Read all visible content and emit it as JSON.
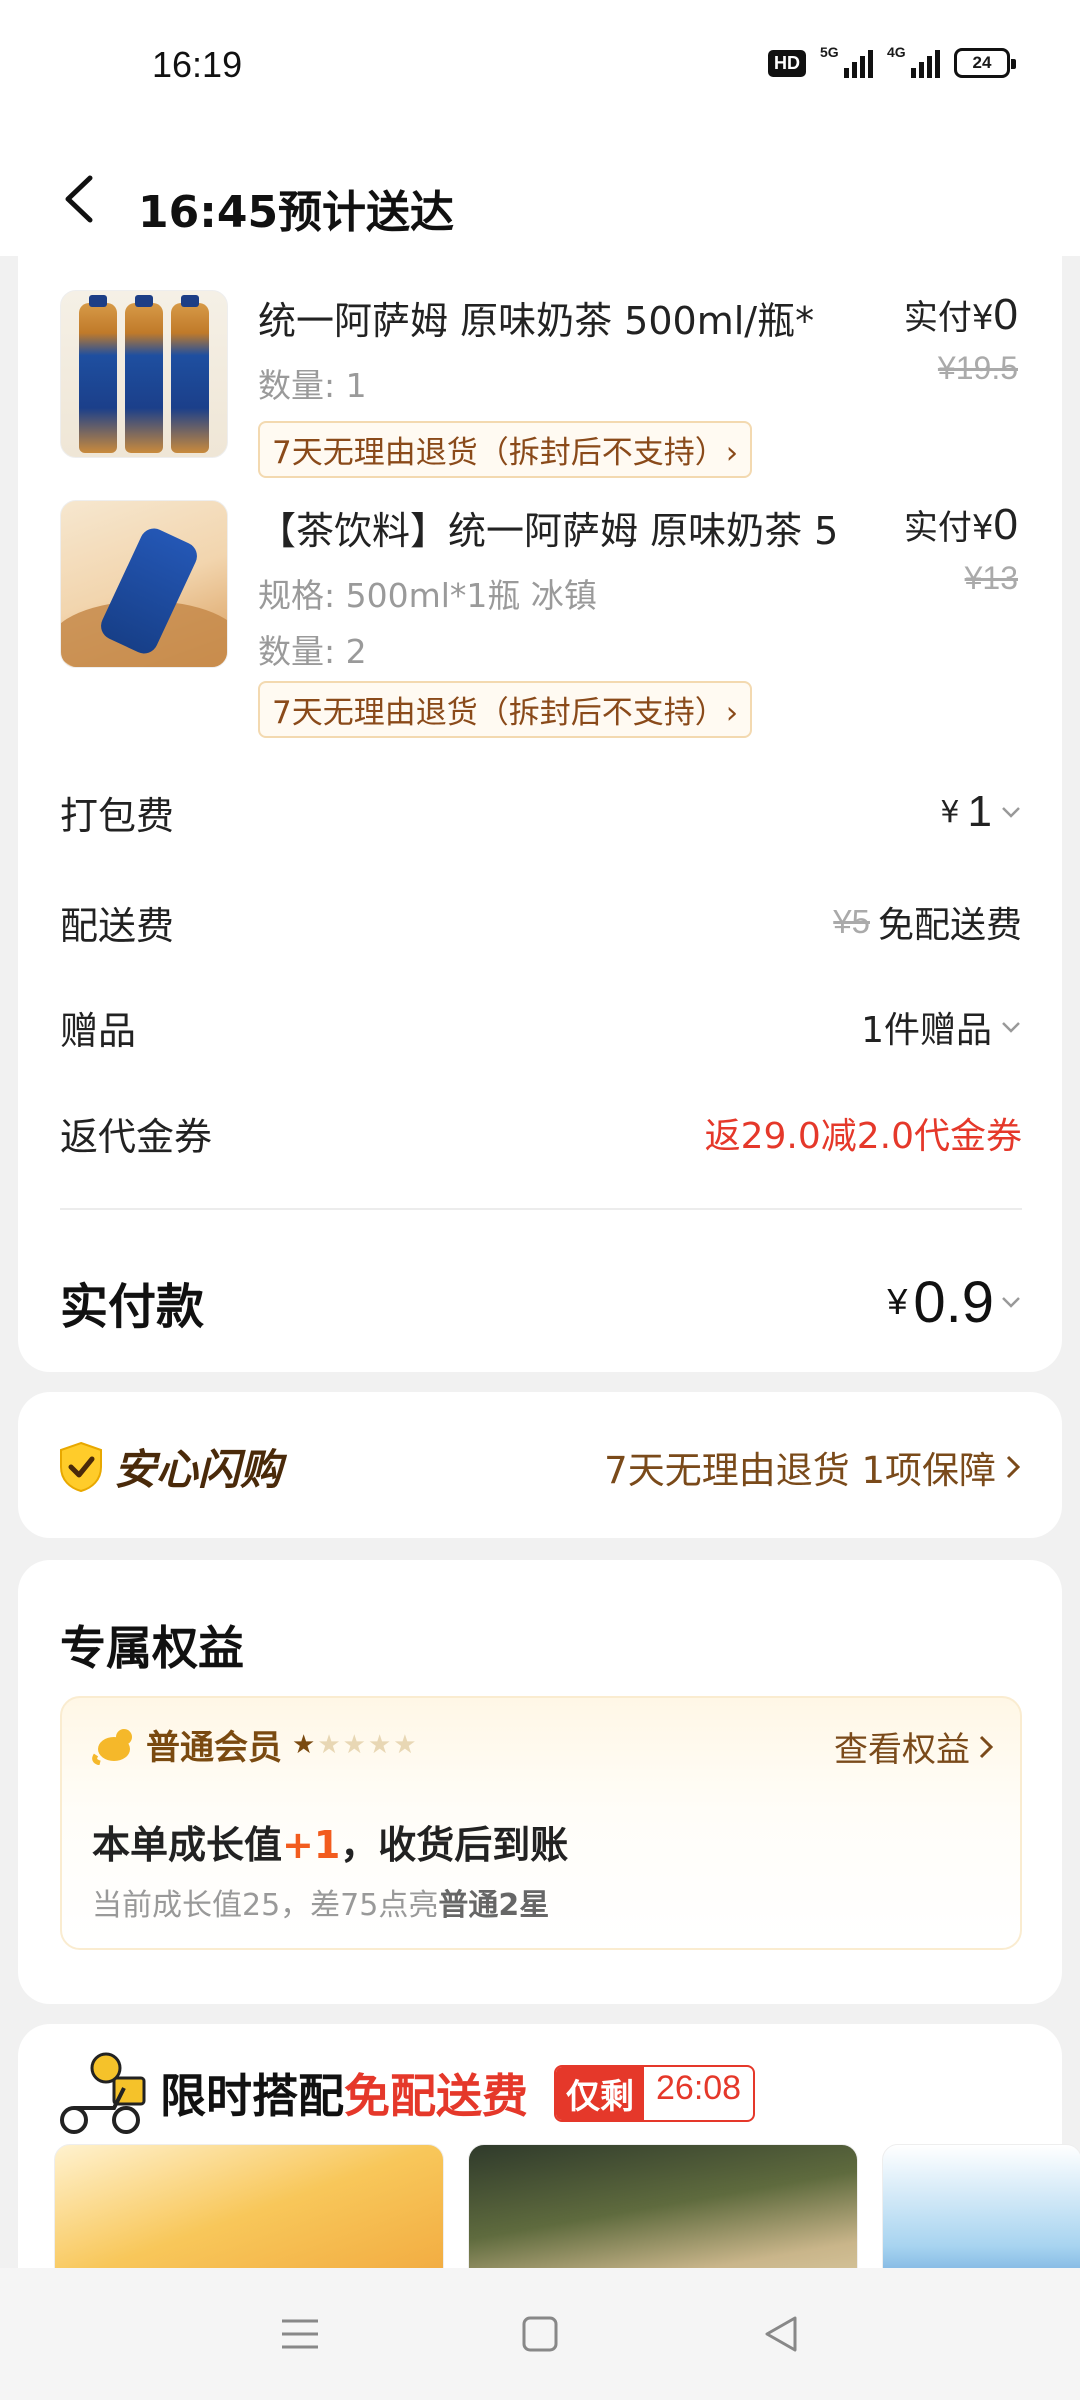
{
  "status_bar": {
    "time": "16:19",
    "hd": "HD",
    "net1": "5G",
    "net2": "4G",
    "battery": "24"
  },
  "header": {
    "title": "16:45预计送达"
  },
  "products": [
    {
      "name": "统一阿萨姆 原味奶茶 500ml/瓶*",
      "qty": "数量: 1",
      "paid_label": "实付¥",
      "paid_value": "0",
      "original_price": "¥19.5",
      "return_tag": "7天无理由退货（拆封后不支持）›"
    },
    {
      "name": "【茶饮料】统一阿萨姆 原味奶茶 5",
      "spec": "规格: 500ml*1瓶 冰镇",
      "qty": "数量: 2",
      "paid_label": "实付¥",
      "paid_value": "0",
      "original_price": "¥13",
      "return_tag": "7天无理由退货（拆封后不支持）›"
    }
  ],
  "fees": {
    "packing_label": "打包费",
    "packing_yen": "¥",
    "packing_value": "1",
    "delivery_label": "配送费",
    "delivery_original": "¥5",
    "delivery_value": "免配送费",
    "gift_label": "赠品",
    "gift_value": "1件赠品",
    "voucher_label": "返代金券",
    "voucher_value": "返29.0减2.0代金券"
  },
  "total": {
    "label": "实付款",
    "yen": "¥",
    "value": "0.9"
  },
  "safe_buy": {
    "title": "安心闪购",
    "detail": "7天无理由退货 1项保障"
  },
  "benefits": {
    "title": "专属权益",
    "member_level": "普通会员",
    "stars_on": 1,
    "stars_total": 5,
    "view_link": "查看权益",
    "growth_prefix": "本单成长值",
    "growth_value": "+1",
    "growth_suffix": "，收货后到账",
    "growth_sub_prefix": "当前成长值25，差75点亮",
    "growth_sub_target": "普通2星"
  },
  "flash": {
    "title_prefix": "限时搭配",
    "title_highlight": "免配送费",
    "timer_label": "仅剩",
    "timer_value": "26:08"
  },
  "colors": {
    "accent_red": "#e5382a",
    "brown": "#7a4a1a",
    "orange": "#f25c1e"
  }
}
